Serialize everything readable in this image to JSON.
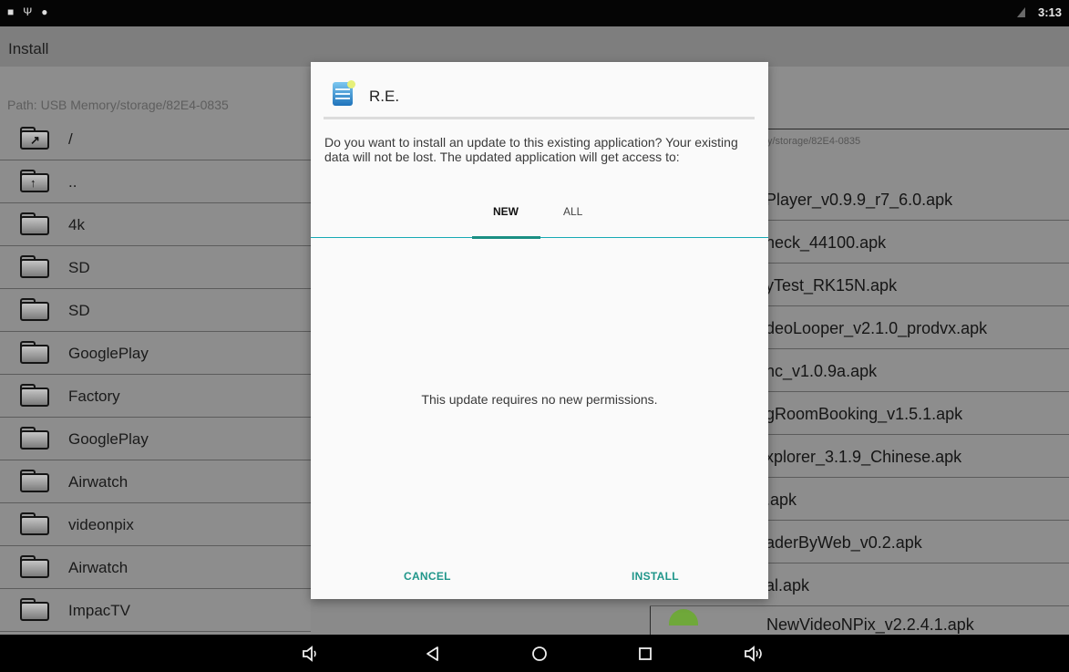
{
  "status_bar": {
    "time": "3:13",
    "icons": [
      "notification-icon",
      "usb-icon",
      "android-debug-icon"
    ],
    "signal_icon": "no-sim-icon"
  },
  "app_bar": {
    "title": "Install"
  },
  "left_panel": {
    "path": "Path:  USB Memory/storage/82E4-0835",
    "items": [
      {
        "label": "/",
        "icon": "folder-root-icon"
      },
      {
        "label": "..",
        "icon": "folder-up-icon"
      },
      {
        "label": "4k",
        "icon": "folder-icon"
      },
      {
        "label": "SD",
        "icon": "folder-icon"
      },
      {
        "label": "SD",
        "icon": "folder-icon"
      },
      {
        "label": "GooglePlay",
        "icon": "folder-icon"
      },
      {
        "label": "Factory",
        "icon": "folder-icon"
      },
      {
        "label": "GooglePlay",
        "icon": "folder-icon"
      },
      {
        "label": "Airwatch",
        "icon": "folder-icon"
      },
      {
        "label": "videonpix",
        "icon": "folder-icon"
      },
      {
        "label": "Airwatch",
        "icon": "folder-icon"
      },
      {
        "label": "ImpacTV",
        "icon": "folder-icon"
      }
    ]
  },
  "right_panel": {
    "path": "y/storage/82E4-0835",
    "items": [
      "Player_v0.9.9_r7_6.0.apk",
      "neck_44100.apk",
      "yTest_RK15N.apk",
      "deoLooper_v2.1.0_prodvx.apk",
      "nc_v1.0.9a.apk",
      "gRoomBooking_v1.5.1.apk",
      "xplorer_3.1.9_Chinese.apk",
      ".apk",
      "aderByWeb_v0.2.apk",
      "al.apk",
      "NewVideoNPix_v2.2.4.1.apk"
    ]
  },
  "dialog": {
    "app_name": "R.E.",
    "app_icon": "root-explorer-icon",
    "message": "Do you want to install an update to this existing application? Your existing data will not be lost. The updated application will get access to:",
    "tabs": {
      "new": "NEW",
      "all": "ALL"
    },
    "body_text": "This update requires no new permissions.",
    "cancel_label": "CANCEL",
    "install_label": "INSTALL",
    "accent_color": "#20968a"
  },
  "nav_bar": {
    "icons": [
      "volume-down-icon",
      "back-icon",
      "home-icon",
      "recents-icon",
      "volume-up-icon"
    ]
  }
}
